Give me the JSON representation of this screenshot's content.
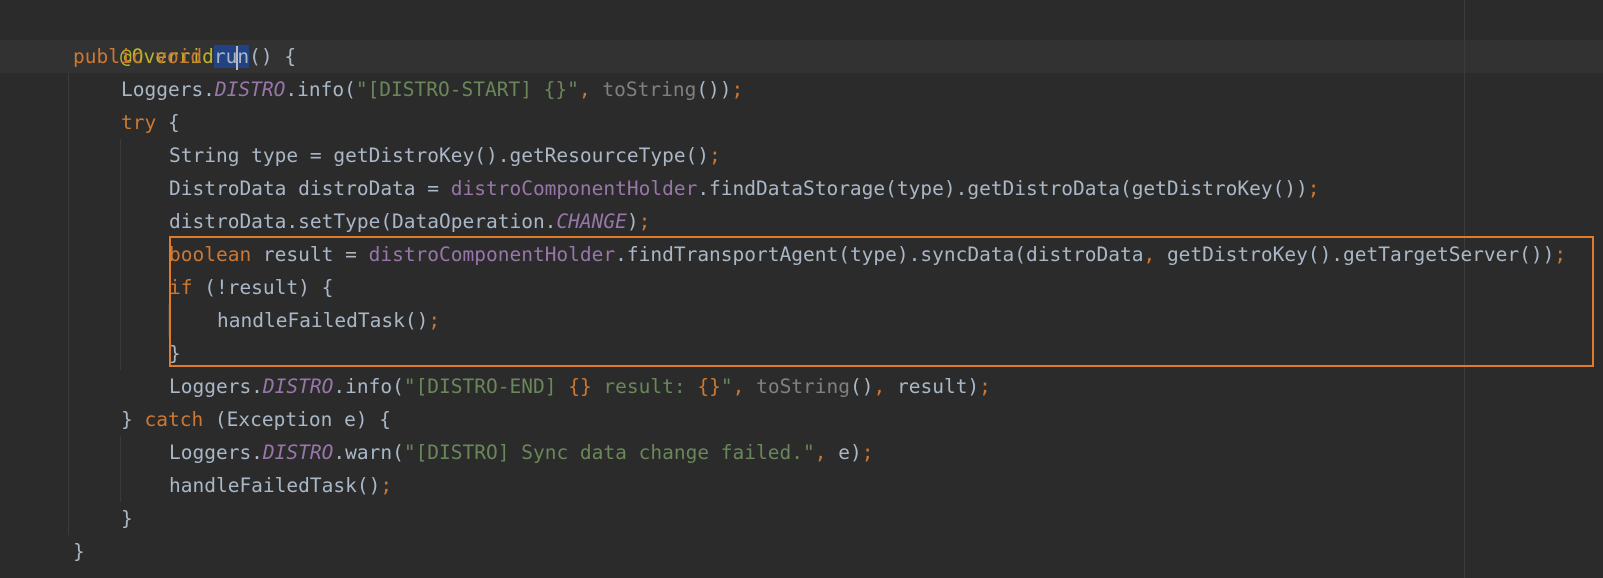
{
  "code": {
    "l1": {
      "annotation": "@Override"
    },
    "l2": {
      "public": "public",
      "void": "void",
      "name_a": "ru",
      "name_b": "n",
      "rest": "() {"
    },
    "l3": {
      "recv": "Loggers.",
      "field": "DISTRO",
      "call": ".info(",
      "str": "\"[DISTRO-START] {}\"",
      "comma": ",",
      "tostr": "toString",
      "tail": "())",
      "semi": ";"
    },
    "l4": {
      "try": "try",
      "rest": " {"
    },
    "l5": {
      "text": "String type = getDistroKey().getResourceType()",
      "semi": ";"
    },
    "l6": {
      "a": "DistroData distroData = ",
      "field": "distroComponentHolder",
      "b": ".findDataStorage(type).getDistroData(getDistroKey())",
      "semi": ";"
    },
    "l7": {
      "a": "distroData.setType(DataOperation.",
      "field": "CHANGE",
      "b": ")",
      "semi": ";"
    },
    "l8": {
      "kw": "boolean",
      "a": " result = ",
      "field": "distroComponentHolder",
      "b": ".findTransportAgent(type).syncData(distroData",
      "comma": ",",
      "c": " getDistroKey().getTargetServer())",
      "semi": ";"
    },
    "l9": {
      "kw": "if",
      "rest": " (!result) {"
    },
    "l10": {
      "text": "handleFailedTask()",
      "semi": ";"
    },
    "l11": {
      "text": "}"
    },
    "l12": {
      "recv": "Loggers.",
      "field": "DISTRO",
      "call": ".info(",
      "str1": "\"[DISTRO-END] ",
      "braces1": "{}",
      "str2": " result: ",
      "braces2": "{}",
      "str3": "\"",
      "comma1": ",",
      "tostr": " toString",
      "mid": "()",
      "comma2": ",",
      "tail": " result)",
      "semi": ";"
    },
    "l13": {
      "close": "} ",
      "catch": "catch",
      "rest": " (Exception e) {"
    },
    "l14": {
      "recv": "Loggers.",
      "field": "DISTRO",
      "call": ".warn(",
      "str": "\"[DISTRO] Sync data change failed.\"",
      "comma": ",",
      "tail": " e)",
      "semi": ";"
    },
    "l15": {
      "text": "handleFailedTask()",
      "semi": ";"
    },
    "l16": {
      "text": "}"
    },
    "l17": {
      "text": "}"
    }
  },
  "colors": {
    "background": "#2b2b2b",
    "keyword": "#cc7832",
    "annotation": "#bbb529",
    "string": "#6a8759",
    "field": "#9876aa",
    "highlight_box": "#e07b2a",
    "selection": "#214283"
  }
}
